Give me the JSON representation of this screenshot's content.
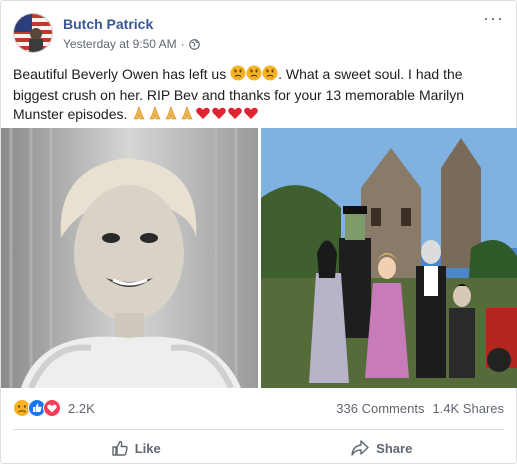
{
  "post": {
    "author": "Butch Patrick",
    "timestamp": "Yesterday at 9:50 AM",
    "separator": "·",
    "privacy_icon": "globe-icon",
    "more_icon": "more-options-icon",
    "message_part1": "Beautiful Beverly Owen has left us ",
    "message_part2": ". What a sweet soul. I had the biggest crush on her. RIP Bev and thanks for your 13 memorable Marilyn Munster episodes. ",
    "message_emojis": [
      "sad-face",
      "sad-face",
      "sad-face",
      "folded-hands",
      "folded-hands",
      "folded-hands",
      "folded-hands",
      "red-heart",
      "red-heart",
      "red-heart",
      "red-heart"
    ]
  },
  "photos": [
    {
      "name": "beverly-owen-portrait",
      "style": "black-and-white"
    },
    {
      "name": "munster-family-photo",
      "style": "color"
    }
  ],
  "stats": {
    "reactions": [
      "sad-reaction-icon",
      "like-reaction-icon",
      "love-reaction-icon"
    ],
    "reaction_count": "2.2K",
    "comments": "336 Comments",
    "shares": "1.4K Shares"
  },
  "actions": {
    "like_label": "Like",
    "share_label": "Share"
  },
  "colors": {
    "author_link": "#385898",
    "meta_gray": "#616770",
    "like_blue": "#1877f2",
    "love_red": "#f33e58",
    "sad_yellow": "#f7b125"
  }
}
